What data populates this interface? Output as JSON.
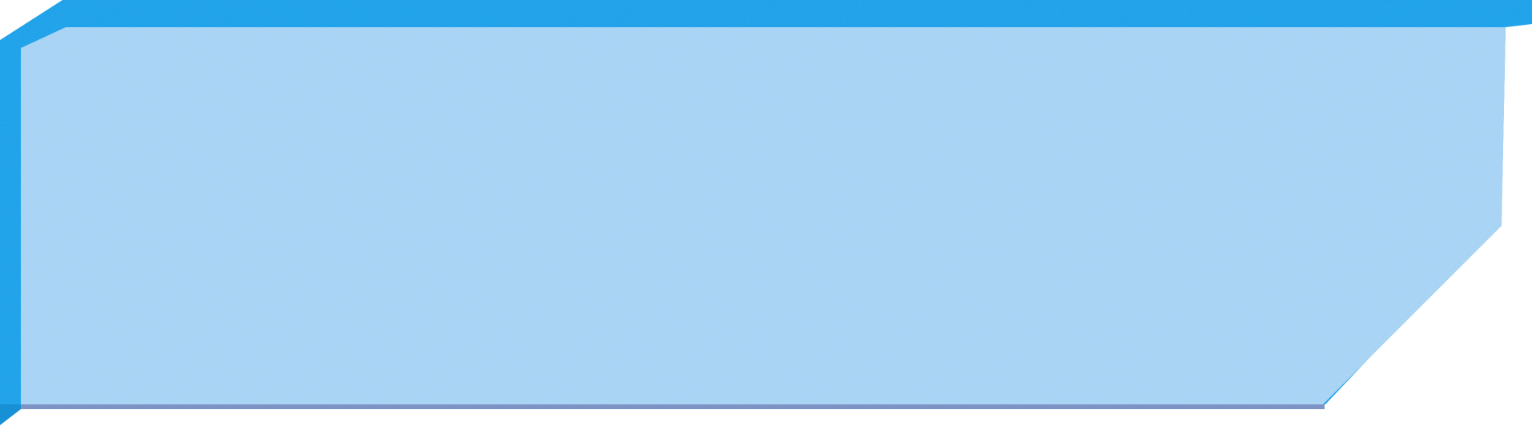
{
  "panel": {
    "colors": {
      "frame": "#1ea3ea",
      "frame_dark": "#1890d6",
      "face": "#a9d4f5",
      "face_tint": "#b3c3f2",
      "bottom_edge": "#7d93c4",
      "background": "#ffffff"
    }
  }
}
